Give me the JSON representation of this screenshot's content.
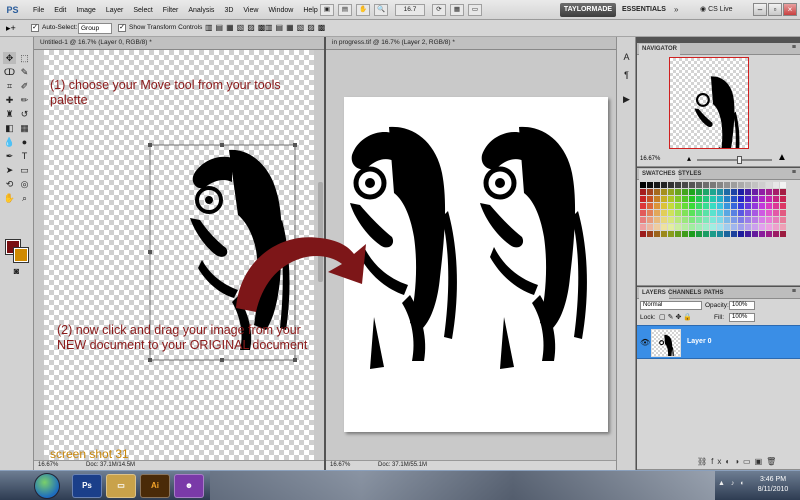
{
  "app": {
    "logo": "PS"
  },
  "menu": {
    "items": [
      "File",
      "Edit",
      "Image",
      "Layer",
      "Select",
      "Filter",
      "Analysis",
      "3D",
      "View",
      "Window",
      "Help"
    ]
  },
  "menubar": {
    "zoom": "16.7",
    "workspace_active": "TAYLORMADE",
    "workspace_essentials": "ESSENTIALS",
    "cs_live": "CS Live",
    "win_minimize": "–",
    "win_restore": "▫",
    "win_close": "×"
  },
  "options": {
    "auto_select_label": "Auto-Select:",
    "auto_select_value": "Group",
    "show_transform_label": "Show Transform Controls"
  },
  "documents": [
    {
      "tab": "Untitled-1 @ 16.7% (Layer 0, RGB/8) *",
      "status_zoom": "16.67%",
      "status_doc": "Doc: 37.1M/14.5M"
    },
    {
      "tab": "in progress.tif @ 16.7% (Layer 2, RGB/8) *",
      "status_zoom": "16.67%",
      "status_doc": "Doc: 37.1M/55.1M"
    }
  ],
  "annotations": {
    "step1": "(1) choose your Move tool from your tools palette",
    "step2": "(2) now click and drag your image from your NEW document to your ORIGINAL document",
    "screenshot_label": "screen shot 31"
  },
  "navigator": {
    "tab": "NAVIGATOR",
    "zoom": "16.67%"
  },
  "swatches": {
    "tab_swatches": "SWATCHES",
    "tab_styles": "STYLES"
  },
  "layers": {
    "tab_layers": "LAYERS",
    "tab_channels": "CHANNELS",
    "tab_paths": "PATHS",
    "blend_mode": "Normal",
    "opacity_label": "Opacity:",
    "opacity_value": "100%",
    "lock_label": "Lock:",
    "fill_label": "Fill:",
    "fill_value": "100%",
    "layer_name": "Layer 0"
  },
  "taskbar": {
    "clock_time": "3:46 PM",
    "clock_date": "8/11/2010"
  },
  "colors": {
    "foreground": "#7a1012",
    "background": "#d08a00",
    "annotation": "#8b1a1a",
    "label": "#c8860a",
    "selection": "#3a8ee6"
  }
}
